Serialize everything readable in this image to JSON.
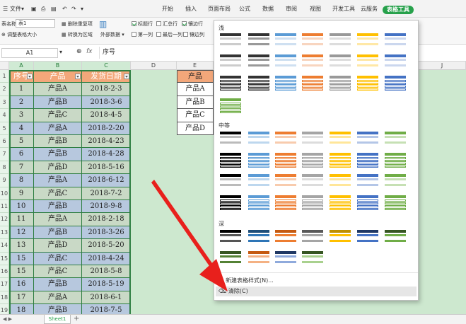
{
  "topbar": {
    "file_label": "文件",
    "tabs": [
      "开始",
      "插入",
      "页面布局",
      "公式",
      "数据",
      "审阅",
      "视图",
      "开发工具",
      "云服务"
    ],
    "active_tab": "表格工具"
  },
  "ribbon": {
    "table_name_label": "表名称:",
    "table_name_value": "表1",
    "resize_table": "调整表格大小",
    "remove_duplicates": "删除重复项",
    "convert_to_range": "转换为区域",
    "external_data": "外部数据",
    "header_row": "标题行",
    "total_row": "汇总行",
    "banded_rows": "镶边行",
    "first_column": "第一列",
    "last_column": "最后一列",
    "banded_columns": "镶边列"
  },
  "formula_bar": {
    "name_box": "A1",
    "fx": "fx",
    "content": "序号"
  },
  "columns": [
    "A",
    "B",
    "C",
    "D",
    "E",
    "J"
  ],
  "table": {
    "headers": [
      "序号",
      "产品",
      "发货日期"
    ],
    "rows": [
      [
        "1",
        "产品A",
        "2018-2-3"
      ],
      [
        "2",
        "产品B",
        "2018-3-6"
      ],
      [
        "3",
        "产品C",
        "2018-4-5"
      ],
      [
        "4",
        "产品A",
        "2018-2-20"
      ],
      [
        "5",
        "产品B",
        "2018-4-23"
      ],
      [
        "6",
        "产品B",
        "2018-4-28"
      ],
      [
        "7",
        "产品D",
        "2018-5-16"
      ],
      [
        "8",
        "产品A",
        "2018-6-12"
      ],
      [
        "9",
        "产品C",
        "2018-7-2"
      ],
      [
        "10",
        "产品B",
        "2018-9-8"
      ],
      [
        "11",
        "产品A",
        "2018-2-18"
      ],
      [
        "12",
        "产品B",
        "2018-3-26"
      ],
      [
        "13",
        "产品D",
        "2018-5-20"
      ],
      [
        "15",
        "产品C",
        "2018-4-24"
      ],
      [
        "15",
        "产品C",
        "2018-5-8"
      ],
      [
        "16",
        "产品B",
        "2018-5-19"
      ],
      [
        "17",
        "产品A",
        "2018-6-1"
      ],
      [
        "18",
        "产品B",
        "2018-7-5"
      ]
    ],
    "row_numbers": [
      "1",
      "2",
      "3",
      "4",
      "5",
      "6",
      "7",
      "8",
      "9",
      "10",
      "11",
      "12",
      "13",
      "14",
      "15",
      "16",
      "17",
      "18",
      "19"
    ]
  },
  "side_table": {
    "header": "产品",
    "items": [
      "产品A",
      "产品B",
      "产品C",
      "产品D"
    ]
  },
  "dropdown": {
    "section_light": "浅",
    "section_medium": "中等",
    "section_dark": "深",
    "new_style": "新建表格样式(N)...",
    "clear": "清除(C)"
  },
  "sheetbar": {
    "sheet_name": "Sheet1",
    "add": "+"
  },
  "colors": {
    "accent": "#27a14b",
    "header_orange": "#f3a77a",
    "band_blue": "#b7c8de",
    "band_green": "#c9d9c6",
    "arrow": "#e8201c"
  }
}
